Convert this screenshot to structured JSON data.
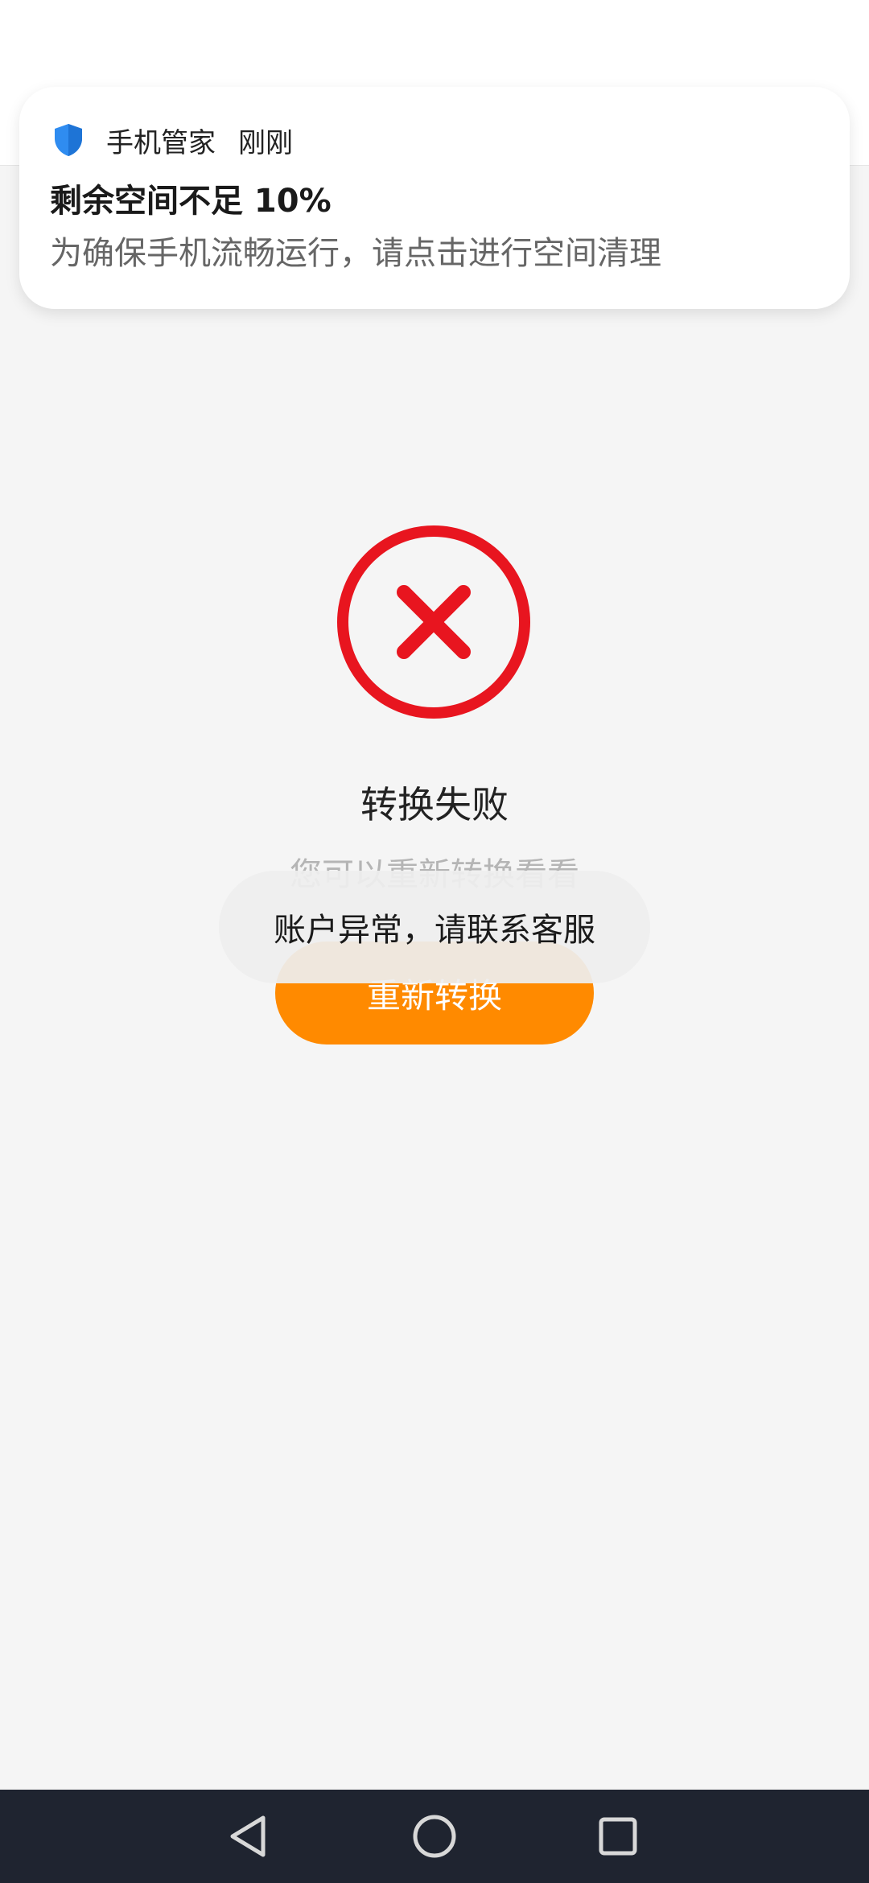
{
  "notification": {
    "app_icon": "shield-icon",
    "app_name": "手机管家",
    "time": "刚刚",
    "title": "剩余空间不足 10%",
    "body": "为确保手机流畅运行，请点击进行空间清理"
  },
  "error": {
    "icon": "error-x-circle-icon",
    "title": "转换失败",
    "subtitle": "您可以重新转换看看",
    "retry_label": "重新转换"
  },
  "toast": {
    "message": "账户异常，请联系客服"
  },
  "nav": {
    "back_icon": "back-triangle-icon",
    "home_icon": "home-circle-icon",
    "recent_icon": "recent-apps-square-icon"
  },
  "colors": {
    "accent": "#ff8a00",
    "error_red": "#e8151f",
    "shield_blue": "#2f8cf0",
    "nav_bg": "#1f2430"
  }
}
